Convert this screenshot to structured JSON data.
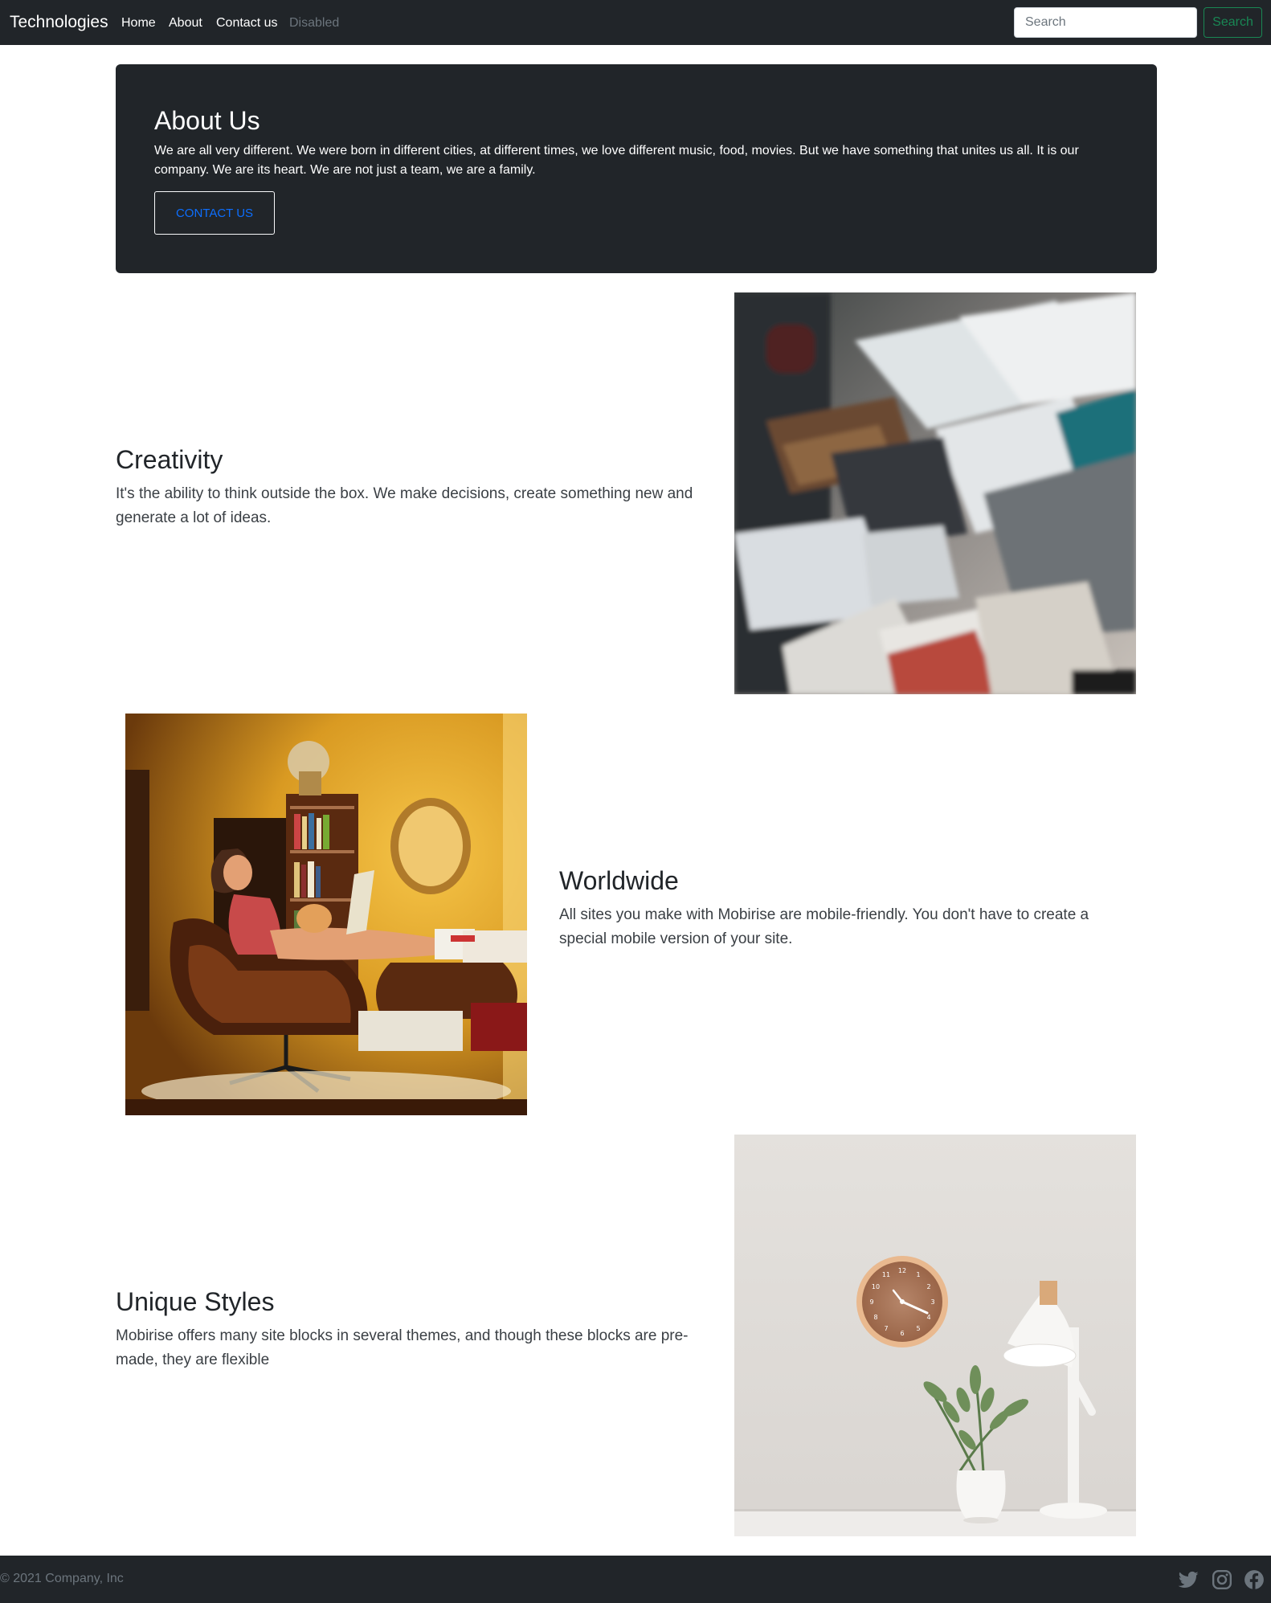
{
  "navbar": {
    "brand": "Technologies",
    "links": [
      {
        "label": "Home"
      },
      {
        "label": "About"
      },
      {
        "label": "Contact us"
      },
      {
        "label": "Disabled"
      }
    ],
    "search": {
      "placeholder": "Search",
      "button_label": "Search"
    }
  },
  "hero": {
    "title": "About Us",
    "text": "We are all very different. We were born in different cities, at different times, we love different music, food, movies. But we have something that unites us all. It is our company. We are its heart. We are not just a team, we are a family.",
    "button_label": "CONTACT US"
  },
  "features": [
    {
      "title": "Creativity",
      "text": "It's the ability to think outside the box. We make decisions, create something new and generate a lot of ideas."
    },
    {
      "title": "Worldwide",
      "text": "All sites you make with Mobirise are mobile-friendly. You don't have to create a special mobile version of your site."
    },
    {
      "title": "Unique Styles",
      "text": "Mobirise offers many site blocks in several themes, and though these blocks are pre-made, they are flexible"
    }
  ],
  "clock_numbers": [
    "12",
    "1",
    "2",
    "3",
    "4",
    "5",
    "6",
    "7",
    "8",
    "9",
    "10",
    "11"
  ],
  "footer": {
    "copyright": "© 2021 Company, Inc",
    "social_icons": [
      "twitter-icon",
      "instagram-icon",
      "facebook-icon"
    ]
  },
  "colors": {
    "dark": "#212529",
    "muted": "#6c757d",
    "success": "#198754",
    "primary": "#0d6efd"
  }
}
